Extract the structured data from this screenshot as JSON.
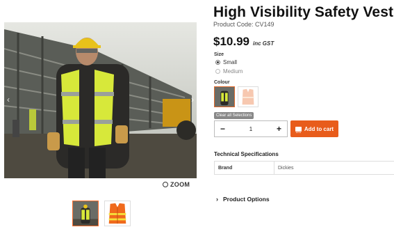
{
  "product": {
    "title": "High Visibility Safety Vest",
    "code": "Product Code: CV149",
    "price": "$10.99",
    "tax_note": "inc GST"
  },
  "gallery": {
    "zoom_label": "ZOOM",
    "thumbnails": [
      "worker-in-vest",
      "orange-vest"
    ]
  },
  "size": {
    "label": "Size",
    "options": [
      {
        "label": "Small",
        "selected": true
      },
      {
        "label": "Medium",
        "selected": false
      }
    ]
  },
  "colour": {
    "label": "Colour",
    "swatches": [
      "yellow-vest",
      "orange-vest-faded"
    ]
  },
  "clear_selections": "Clear all Selections",
  "quantity": {
    "minus": "−",
    "value": "1",
    "plus": "+"
  },
  "add_to_cart": "Add to cart",
  "technical_specifications": {
    "heading": "Technical Specifications",
    "rows": [
      {
        "key": "Brand",
        "value": "Dickies"
      }
    ]
  },
  "product_options": {
    "chevron": "›",
    "label": "Product Options"
  },
  "colors": {
    "accent": "#e85c1b",
    "hi_vis_yellow": "#d7e83a"
  }
}
